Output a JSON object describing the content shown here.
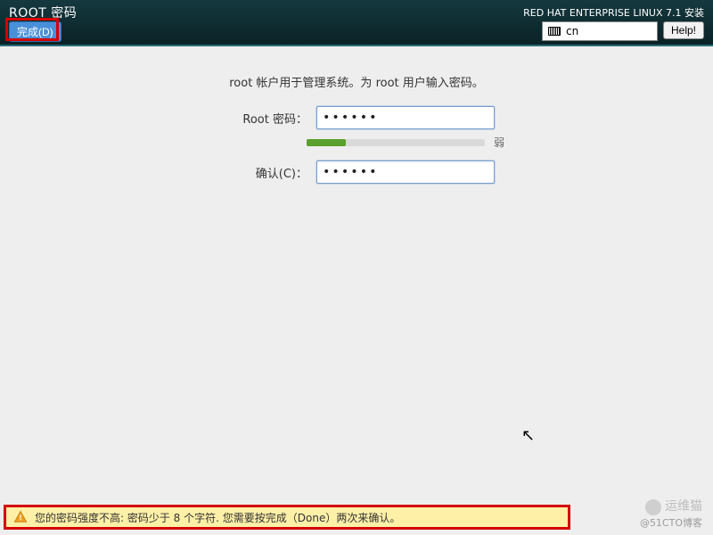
{
  "header": {
    "title": "ROOT 密码",
    "subtitle": "RED HAT ENTERPRISE LINUX 7.1 安装",
    "done_label": "完成(D)",
    "lang_code": "cn",
    "help_label": "Help!"
  },
  "form": {
    "description": "root 帐户用于管理系统。为 root 用户输入密码。",
    "password_label": "Root 密码：",
    "password_value": "••••••",
    "confirm_label": "确认(C)：",
    "confirm_value": "••••••",
    "strength_percent": 22,
    "strength_label": "弱"
  },
  "warning": {
    "text": "您的密码强度不高: 密码少于 8 个字符. 您需要按完成（Done）两次来确认。"
  },
  "watermark": {
    "brand": "运维猫",
    "handle": "@51CTO博客"
  }
}
